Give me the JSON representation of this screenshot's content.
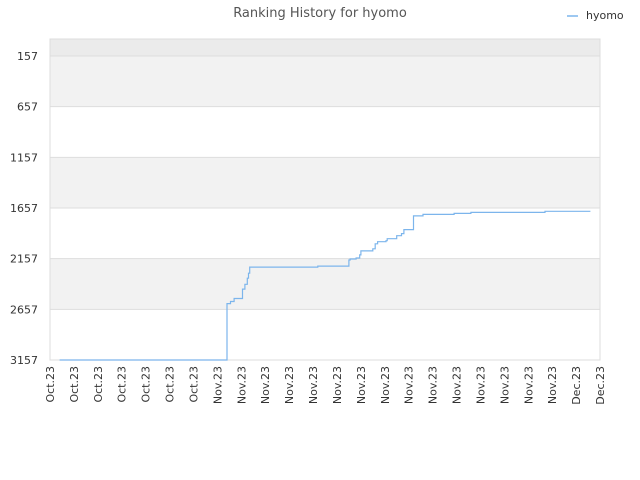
{
  "chart_data": {
    "type": "line",
    "title": "Ranking History for hyomo",
    "xlabel": "",
    "ylabel": "",
    "y_inverted": true,
    "ylim": [
      157,
      3157
    ],
    "yticks": [
      157,
      657,
      1157,
      1657,
      2157,
      2657,
      3157
    ],
    "x_tick_labels": [
      "Oct.23",
      "Oct.23",
      "Oct.23",
      "Oct.23",
      "Oct.23",
      "Oct.23",
      "Oct.23",
      "Nov.23",
      "Nov.23",
      "Nov.23",
      "Nov.23",
      "Nov.23",
      "Nov.23",
      "Nov.23",
      "Nov.23",
      "Nov.23",
      "Nov.23",
      "Nov.23",
      "Nov.23",
      "Nov.23",
      "Nov.23",
      "Nov.23",
      "Dec.23",
      "Dec.23"
    ],
    "grid": true,
    "grid_bands": true,
    "legend_position": "top-right",
    "colors": {
      "series": "#7cb5ec",
      "band": "#f2f2f2",
      "band_top": "#ebebeb",
      "grid": "#dddddd"
    },
    "series": [
      {
        "name": "hyomo",
        "x": [
          0.4,
          7.4,
          7.4,
          7.55,
          7.55,
          7.7,
          7.7,
          8.05,
          8.05,
          8.15,
          8.15,
          8.25,
          8.25,
          8.3,
          8.3,
          8.35,
          8.35,
          8.45,
          8.45,
          11.2,
          11.2,
          12.5,
          12.5,
          12.55,
          12.55,
          12.8,
          12.8,
          12.95,
          12.95,
          13.0,
          13.0,
          13.5,
          13.5,
          13.6,
          13.6,
          13.7,
          13.7,
          14.05,
          14.05,
          14.1,
          14.1,
          14.5,
          14.5,
          14.7,
          14.7,
          14.8,
          14.8,
          15.2,
          15.2,
          15.6,
          15.6,
          16.9,
          16.9,
          17.6,
          17.6,
          20.7,
          20.7,
          22.6
        ],
        "y": [
          3157,
          3157,
          2600,
          2600,
          2580,
          2580,
          2550,
          2550,
          2457,
          2457,
          2410,
          2410,
          2350,
          2350,
          2300,
          2300,
          2240,
          2240,
          2240,
          2240,
          2230,
          2230,
          2170,
          2170,
          2160,
          2160,
          2150,
          2150,
          2120,
          2120,
          2080,
          2080,
          2060,
          2060,
          2010,
          2010,
          1990,
          1990,
          1980,
          1980,
          1960,
          1960,
          1930,
          1930,
          1910,
          1910,
          1870,
          1870,
          1735,
          1735,
          1720,
          1720,
          1710,
          1710,
          1700,
          1700,
          1690,
          1690
        ]
      }
    ]
  }
}
